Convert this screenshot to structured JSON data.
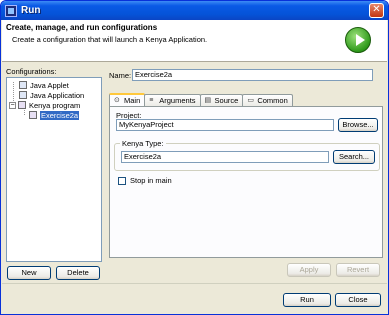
{
  "window": {
    "title": "Run"
  },
  "header": {
    "title": "Create, manage, and run configurations",
    "subtitle": "Create a configuration that will launch a Kenya Application."
  },
  "configurations": {
    "label": "Configurations:",
    "tree": [
      {
        "label": "Java Applet"
      },
      {
        "label": "Java Application"
      },
      {
        "label": "Kenya program",
        "expanded": true
      },
      {
        "label": "Exercise2a",
        "selected": true
      }
    ],
    "new_label": "New",
    "delete_label": "Delete"
  },
  "form": {
    "name_label": "Name:",
    "name_value": "Exercise2a",
    "tabs": [
      {
        "label": "Main",
        "icon": "main-icon",
        "active": true
      },
      {
        "label": "Arguments",
        "icon": "arguments-icon"
      },
      {
        "label": "Source",
        "icon": "source-icon"
      },
      {
        "label": "Common",
        "icon": "common-icon"
      }
    ],
    "project_label": "Project:",
    "project_value": "MyKenyaProject",
    "browse_label": "Browse...",
    "kenya_type_label": "Kenya Type:",
    "kenya_type_value": "Exercise2a",
    "search_label": "Search...",
    "stop_in_main_label": "Stop in main",
    "apply_label": "Apply",
    "revert_label": "Revert"
  },
  "footer": {
    "run_label": "Run",
    "close_label": "Close"
  }
}
